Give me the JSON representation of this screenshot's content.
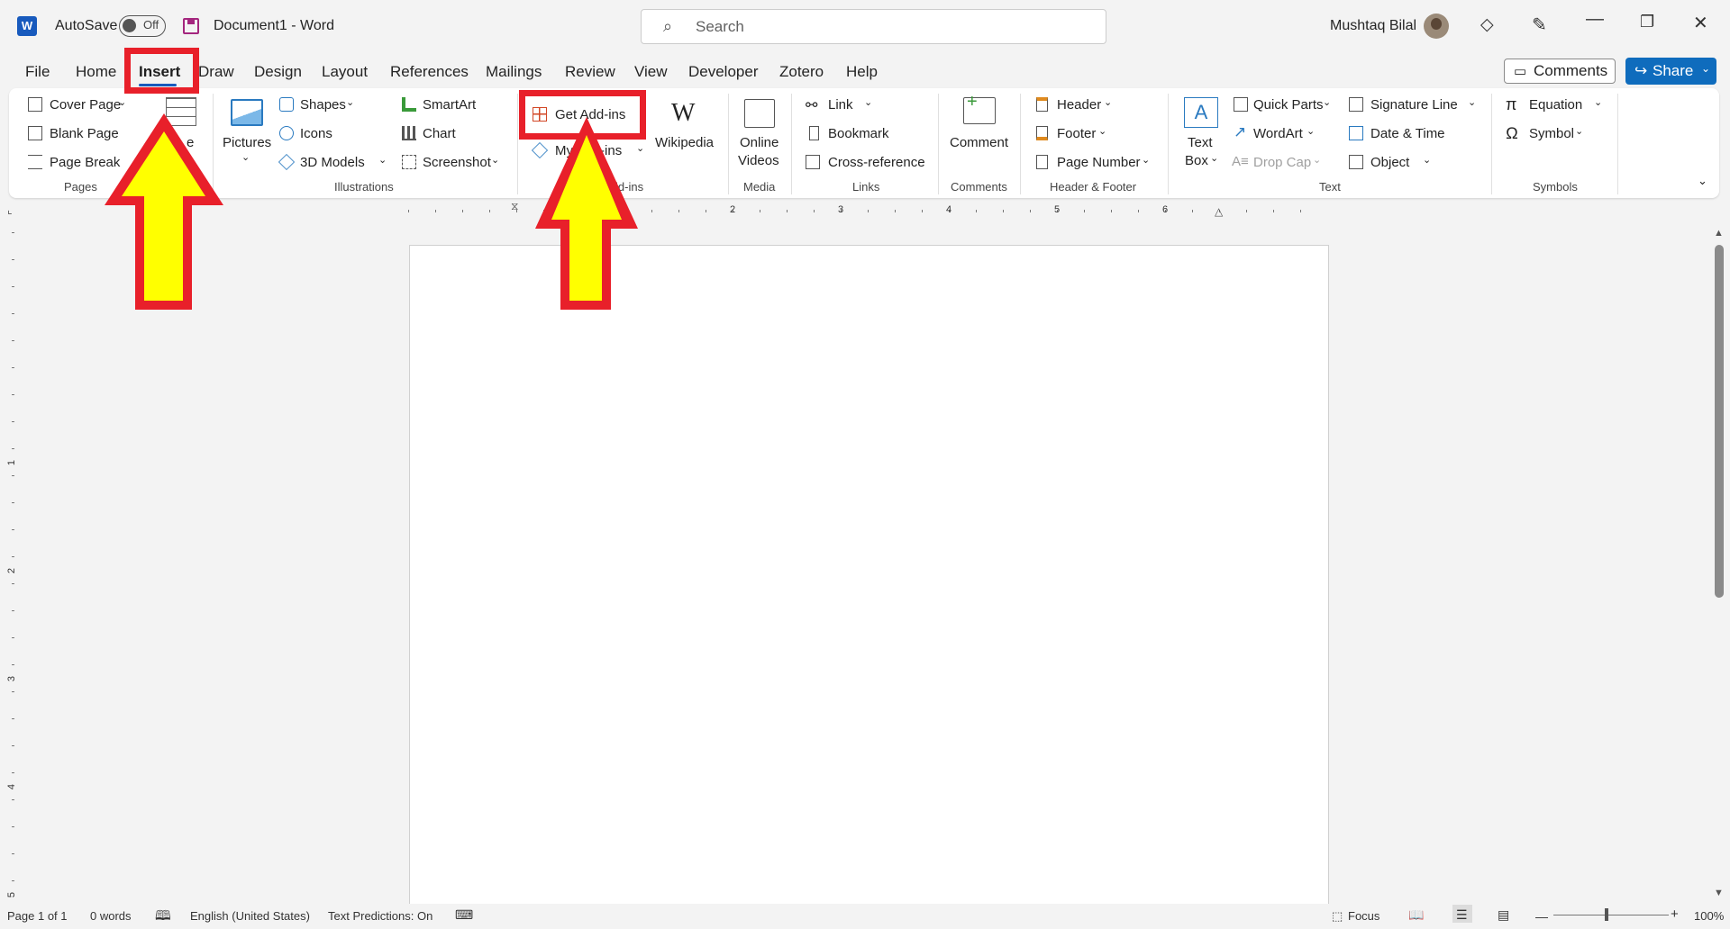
{
  "app": {
    "autosave_label": "AutoSave",
    "autosave_state": "Off",
    "doc_title": "Document1  -  Word",
    "search_placeholder": "Search",
    "user_name": "Mushtaq Bilal"
  },
  "menu": {
    "tabs": [
      "File",
      "Home",
      "Insert",
      "Draw",
      "Design",
      "Layout",
      "References",
      "Mailings",
      "Review",
      "View",
      "Developer",
      "Zotero",
      "Help"
    ],
    "comments_label": "Comments",
    "share_label": "Share"
  },
  "ribbon": {
    "pages": {
      "cover_page": "Cover Page",
      "blank_page": "Blank Page",
      "page_break": "Page Break",
      "group": "Pages"
    },
    "table_partial": "e",
    "illustrations": {
      "pictures": "Pictures",
      "shapes": "Shapes",
      "icons": "Icons",
      "models": "3D Models",
      "smartart": "SmartArt",
      "chart": "Chart",
      "screenshot": "Screenshot",
      "group": "Illustrations"
    },
    "addins": {
      "get": "Get Add-ins",
      "my": "My Add-ins",
      "wikipedia": "Wikipedia",
      "group": "Add-ins"
    },
    "media": {
      "online_videos_1": "Online",
      "online_videos_2": "Videos",
      "group": "Media"
    },
    "links": {
      "link": "Link",
      "bookmark": "Bookmark",
      "cross_reference": "Cross-reference",
      "group": "Links"
    },
    "comments": {
      "comment": "Comment",
      "group": "Comments"
    },
    "header_footer": {
      "header": "Header",
      "footer": "Footer",
      "page_number": "Page Number",
      "group": "Header & Footer"
    },
    "text": {
      "text_box_1": "Text",
      "text_box_2": "Box",
      "quick_parts": "Quick Parts",
      "wordart": "WordArt",
      "drop_cap": "Drop Cap",
      "signature_line": "Signature Line",
      "date_time": "Date & Time",
      "object": "Object",
      "group": "Text"
    },
    "symbols": {
      "equation": "Equation",
      "symbol": "Symbol",
      "group": "Symbols"
    }
  },
  "ruler": {
    "numbers": [
      "1",
      "2",
      "3",
      "4",
      "5",
      "6"
    ],
    "vnumbers": [
      "1",
      "2",
      "3",
      "4",
      "5"
    ]
  },
  "status": {
    "page": "Page 1 of 1",
    "words": "0 words",
    "language": "English (United States)",
    "predictions": "Text Predictions: On",
    "focus": "Focus",
    "zoom": "100%"
  },
  "colors": {
    "word_blue": "#185abd",
    "share_blue": "#0f6cbd",
    "annotation_red": "#e8202a",
    "annotation_yellow": "#ffff00"
  }
}
